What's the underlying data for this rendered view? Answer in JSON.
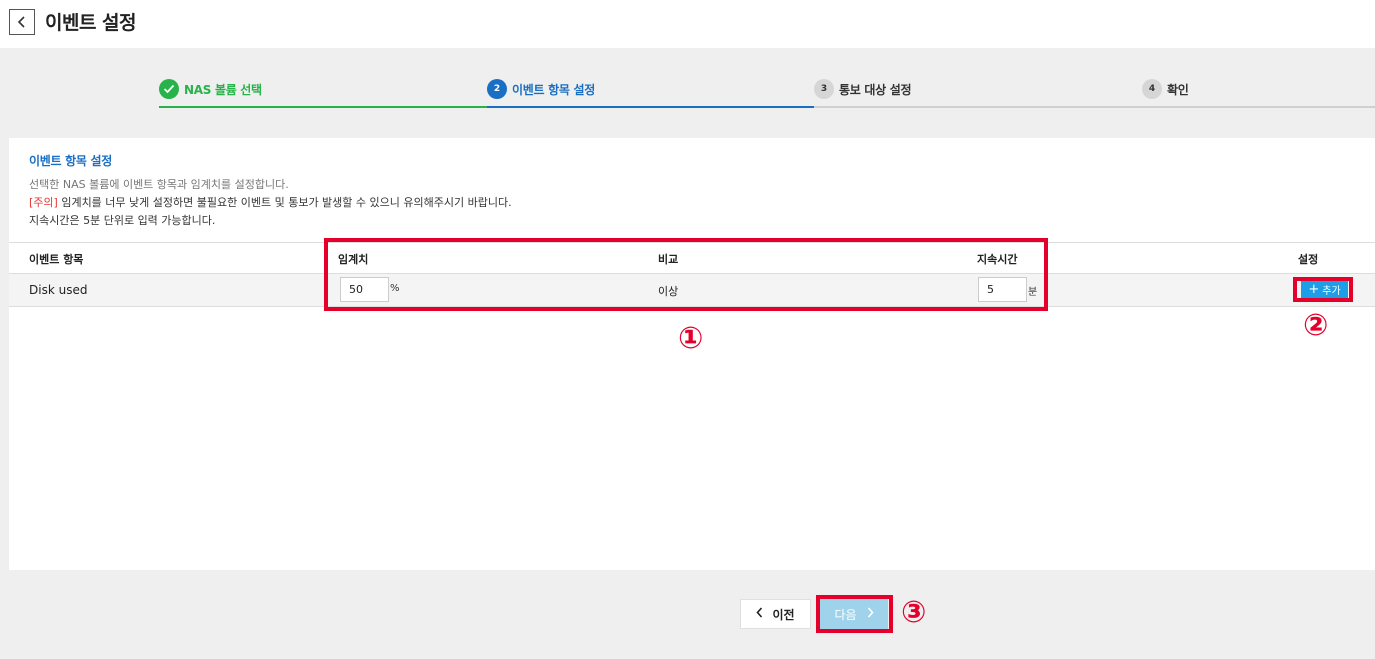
{
  "header": {
    "title": "이벤트 설정",
    "back_icon": "chevron-left-icon"
  },
  "stepper": {
    "steps": [
      {
        "number": "1",
        "label": "NAS 볼륨 선택",
        "state": "done"
      },
      {
        "number": "2",
        "label": "이벤트 항목 설정",
        "state": "active"
      },
      {
        "number": "3",
        "label": "통보 대상 설정",
        "state": "pending"
      },
      {
        "number": "4",
        "label": "확인",
        "state": "pending"
      }
    ],
    "colors": {
      "done": "#27b34a",
      "active": "#1a6fc4",
      "pending": "#d0d0d0"
    }
  },
  "section": {
    "title": "이벤트 항목 설정",
    "desc1": "선택한 NAS 볼륨에 이벤트 항목과 임계치를 설정합니다.",
    "warn_tag": "[주의]",
    "desc2": " 임계치를 너무 낮게 설정하면 불필요한 이벤트 및 통보가 발생할 수 있으니 유의해주시기 바랍니다.",
    "desc3": "지속시간은 5분 단위로 입력 가능합니다."
  },
  "table": {
    "headers": {
      "item": "이벤트 항목",
      "threshold": "임계치",
      "compare": "비교",
      "duration": "지속시간",
      "setting": "설정"
    },
    "rows": [
      {
        "item": "Disk used",
        "threshold": "50",
        "threshold_unit": "%",
        "compare": "이상",
        "duration": "5",
        "duration_unit": "분",
        "add_label": "추가"
      }
    ]
  },
  "annotations": {
    "m1": "①",
    "m2": "②",
    "m3": "③",
    "highlight_color": "#e4002b"
  },
  "footer": {
    "prev_label": "이전",
    "next_label": "다음"
  }
}
